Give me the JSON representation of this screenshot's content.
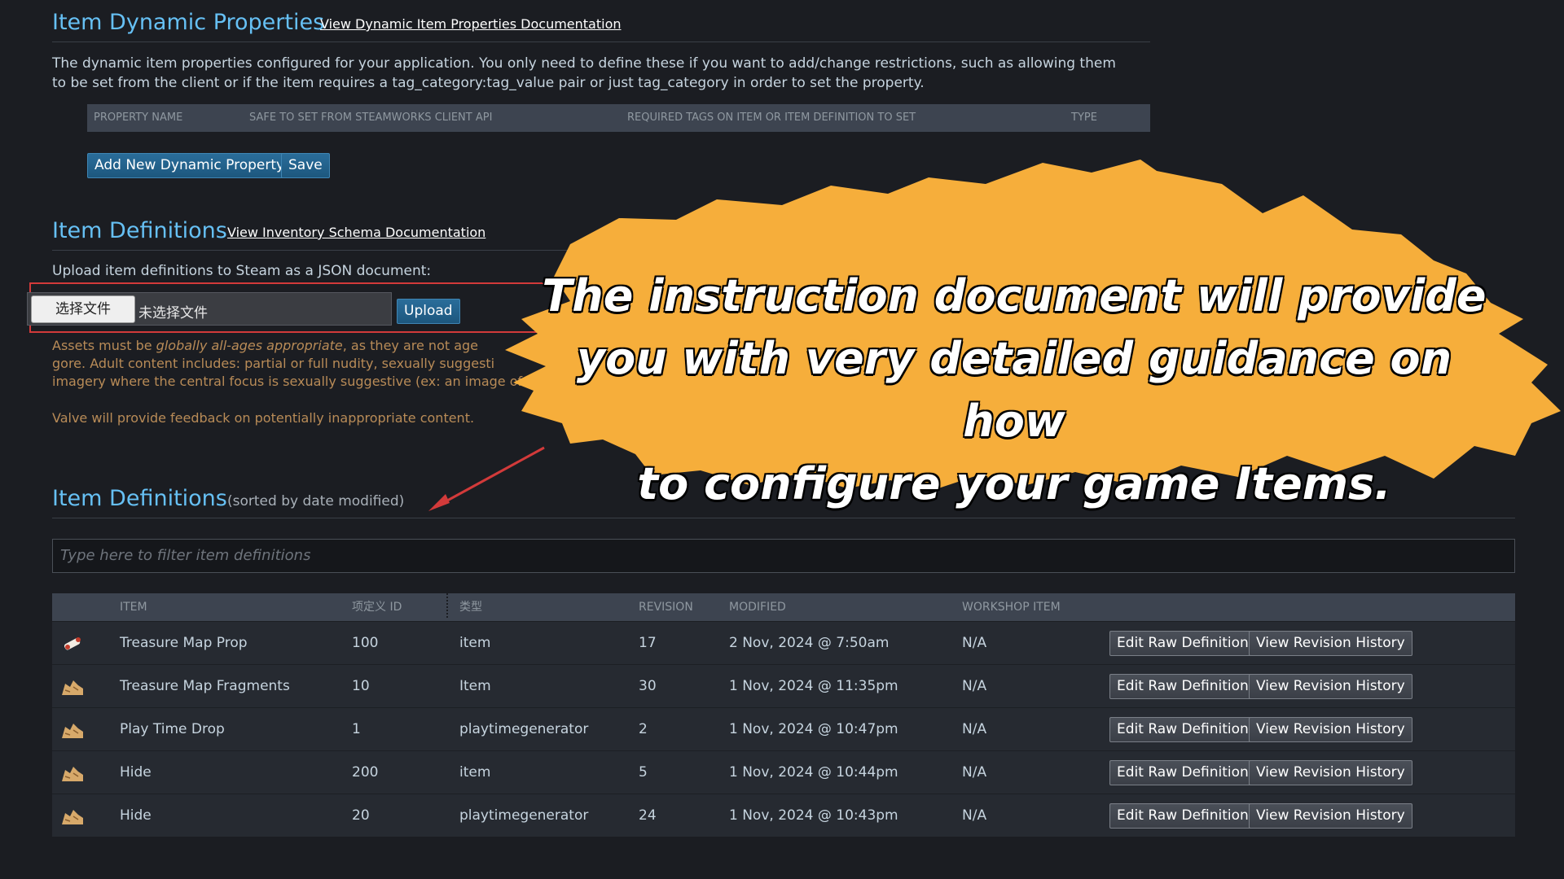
{
  "dynamic": {
    "title": "Item Dynamic Properties",
    "doc_link": "View Dynamic Item Properties Documentation",
    "desc_line1": "The dynamic item properties configured for your application. You only need to define these if you want to add/change restrictions, such as allowing them",
    "desc_line2": "to be set from the client or if the item requires a tag_category:tag_value pair or just tag_category in order to set the property.",
    "columns": [
      "PROPERTY NAME",
      "SAFE TO SET FROM STEAMWORKS CLIENT API",
      "REQUIRED TAGS ON ITEM OR ITEM DEFINITION TO SET",
      "TYPE"
    ],
    "add_button": "Add New Dynamic Property",
    "save_button": "Save"
  },
  "upload": {
    "title": "Item Definitions",
    "doc_link": "View Inventory Schema Documentation",
    "instruction": "Upload item definitions to Steam as a JSON document:",
    "choose_file": "选择文件",
    "no_file": "未选择文件",
    "upload_button": "Upload",
    "warning_prefix": "Assets must be ",
    "warning_emphasis": "globally all-ages appropriate",
    "warning_rest": ", as they are not age",
    "warning_line2": "gore. Adult content includes: partial or full nudity, sexually suggesti",
    "warning_line3": "imagery where the central focus is sexually suggestive (ex: an image of a bra or",
    "feedback": "Valve will provide feedback on potentially inappropriate content."
  },
  "definitions": {
    "title": "Item Definitions",
    "subtitle": "(sorted by date modified)",
    "filter_placeholder": "Type here to filter item definitions",
    "columns": {
      "item": "ITEM",
      "id": "项定义 ID",
      "type": "类型",
      "revision": "REVISION",
      "modified": "MODIFIED",
      "workshop": "WORKSHOP ITEM"
    },
    "rows": [
      {
        "icon": "map-scroll-icon",
        "item": "Treasure Map Prop",
        "id": "100",
        "type": "item",
        "revision": "17",
        "modified": "2 Nov, 2024 @ 7:50am",
        "workshop": "N/A"
      },
      {
        "icon": "map-fragments-icon",
        "item": "Treasure Map Fragments",
        "id": "10",
        "type": "Item",
        "revision": "30",
        "modified": "1 Nov, 2024 @ 11:35pm",
        "workshop": "N/A"
      },
      {
        "icon": "map-fragments-icon",
        "item": "Play Time Drop",
        "id": "1",
        "type": "playtimegenerator",
        "revision": "2",
        "modified": "1 Nov, 2024 @ 10:47pm",
        "workshop": "N/A"
      },
      {
        "icon": "map-fragments-icon",
        "item": "Hide",
        "id": "200",
        "type": "item",
        "revision": "5",
        "modified": "1 Nov, 2024 @ 10:44pm",
        "workshop": "N/A"
      },
      {
        "icon": "map-fragments-icon",
        "item": "Hide",
        "id": "20",
        "type": "playtimegenerator",
        "revision": "24",
        "modified": "1 Nov, 2024 @ 10:43pm",
        "workshop": "N/A"
      }
    ],
    "edit_button": "Edit Raw Definition",
    "history_button": "View Revision History"
  },
  "banner": {
    "line1": "The instruction document will provide",
    "line2": "you with very detailed guidance on how",
    "line3": "to configure your game Items.",
    "color": "#f6ae3b"
  },
  "colors": {
    "accent": "#66c0f4",
    "highlight_border": "#d23a3a",
    "arrow": "#d23a3a"
  }
}
